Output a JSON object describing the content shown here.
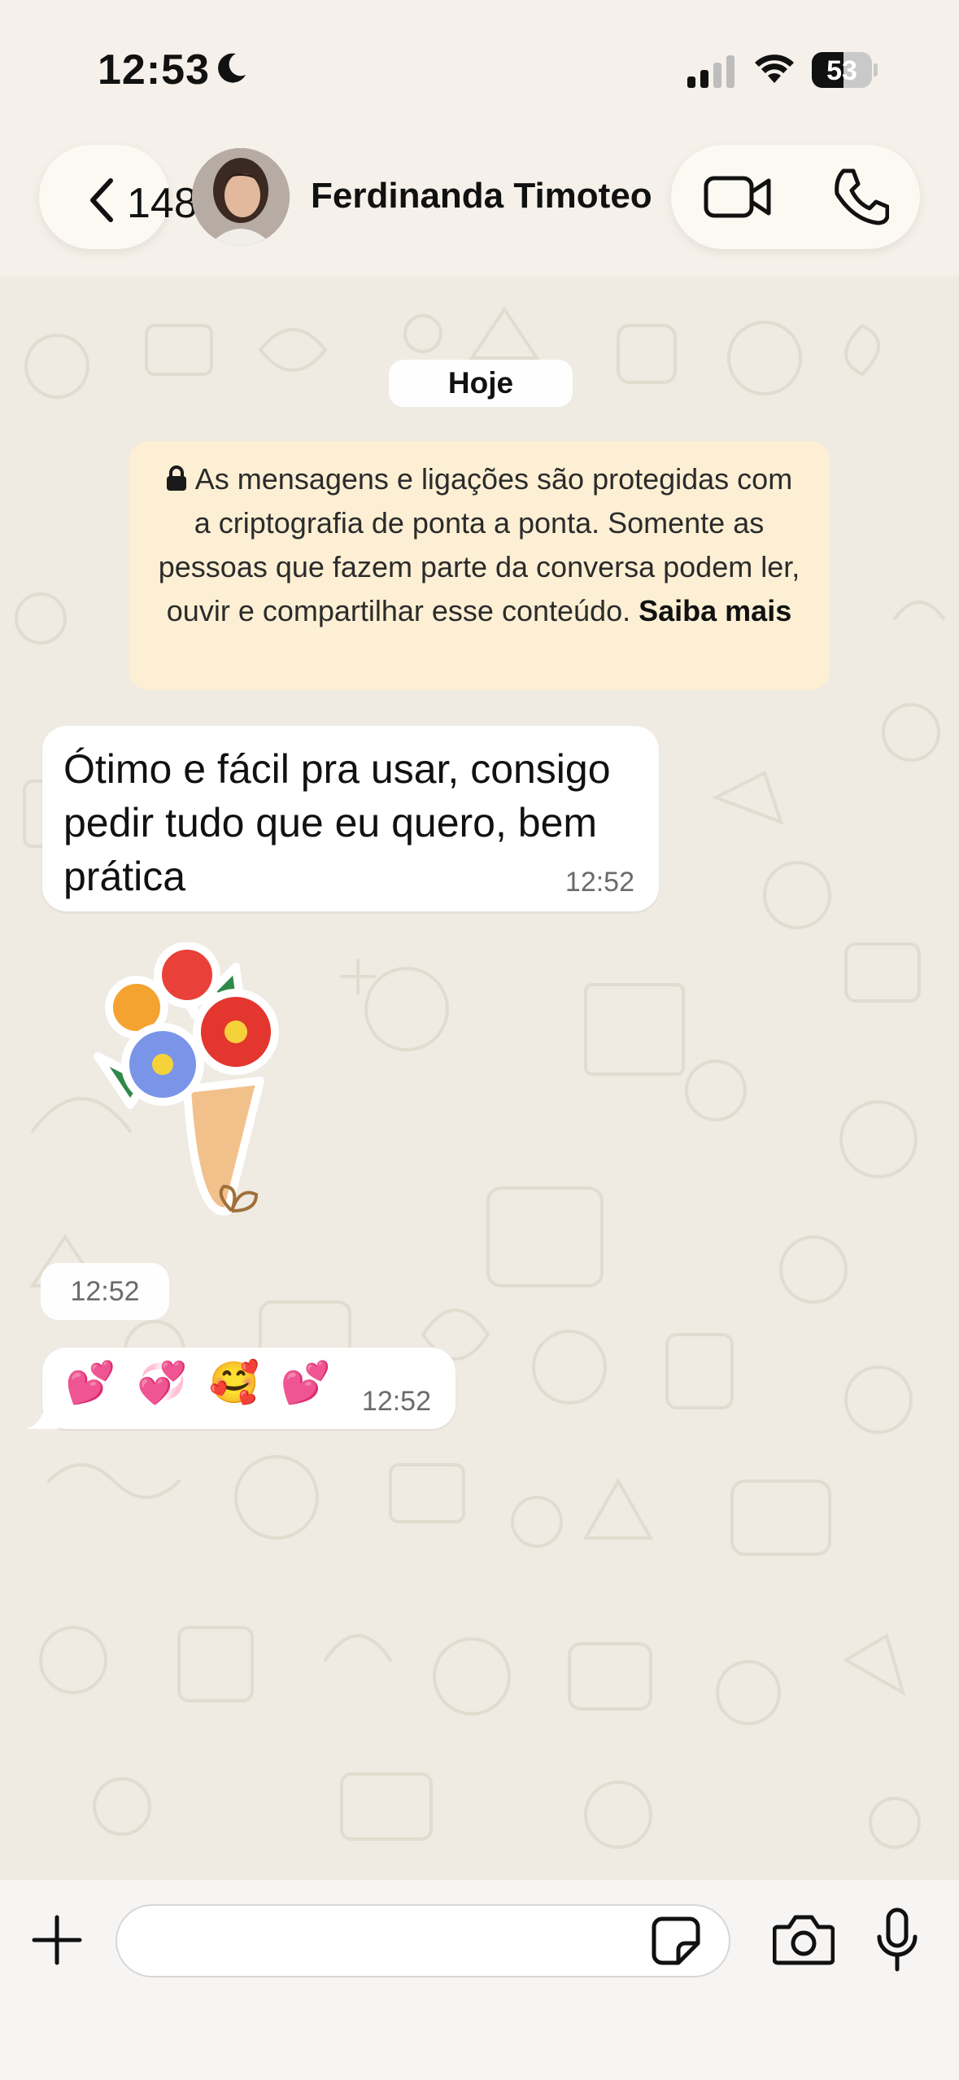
{
  "status_bar": {
    "time": "12:53",
    "battery_level": "53",
    "battery_fraction": 0.53,
    "icons": [
      "moon-icon",
      "cellular-signal-icon",
      "wifi-icon",
      "battery-icon"
    ]
  },
  "header": {
    "back_count": "148",
    "contact_name": "Ferdinanda Timoteo",
    "icons": [
      "chevron-left-icon",
      "video-call-icon",
      "phone-call-icon"
    ]
  },
  "chat": {
    "day_label": "Hoje",
    "encryption_notice": {
      "text": "As mensagens e ligações são protegidas com a criptografia de ponta a ponta. Somente as pessoas que fazem parte da conversa podem ler, ouvir e compartilhar esse conteúdo.",
      "link": "Saiba mais"
    },
    "messages": [
      {
        "type": "text",
        "text": "Ótimo e fácil pra usar, consigo pedir tudo que eu quero, bem prática",
        "time": "12:52"
      },
      {
        "type": "sticker",
        "sticker": "flower-bouquet",
        "time": "12:52"
      },
      {
        "type": "emoji",
        "text": "💕💞🥰💕",
        "time": "12:52"
      }
    ]
  },
  "composer": {
    "placeholder": "",
    "icons": [
      "plus-icon",
      "sticker-icon",
      "camera-icon",
      "microphone-icon"
    ]
  },
  "colors": {
    "background": "#efeae2",
    "bubble_in": "#ffffff",
    "notice": "#fcefd4",
    "header": "#f5f1ea"
  }
}
